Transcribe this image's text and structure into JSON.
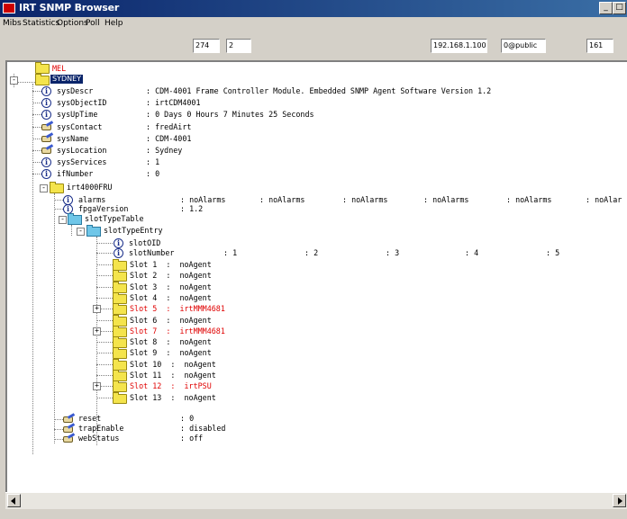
{
  "window": {
    "title": "IRT SNMP Browser"
  },
  "menu": [
    "Mibs",
    "Statistics",
    "Options",
    "Poll",
    "Help"
  ],
  "toolbar": {
    "field1": "274",
    "field2": "2",
    "ip": "192.168.1.100",
    "community": "0@public",
    "port": "161"
  },
  "tree": {
    "root_mel": "MEL",
    "root_sydney": "SYDNEY",
    "system": [
      {
        "name": "sysDescr",
        "sep": ":",
        "value": "CDM-4001 Frame Controller Module. Embedded SNMP Agent Software Version 1.2"
      },
      {
        "name": "sysObjectID",
        "sep": ":",
        "value": "irtCDM4001"
      },
      {
        "name": "sysUpTime",
        "sep": ":",
        "value": "0 Days 0 Hours 7 Minutes 25 Seconds"
      },
      {
        "name": "sysContact",
        "sep": ":",
        "value": "fredAirt"
      },
      {
        "name": "sysName",
        "sep": ":",
        "value": "CDM-4001"
      },
      {
        "name": "sysLocation",
        "sep": ":",
        "value": "Sydney"
      },
      {
        "name": "sysServices",
        "sep": ":",
        "value": "1"
      },
      {
        "name": "ifNumber",
        "sep": ":",
        "value": "0"
      }
    ],
    "fru": {
      "label": "irt4000FRU",
      "alarms_name": "alarms",
      "alarms_values": [
        ": noAlarms",
        ": noAlarms",
        ": noAlarms",
        ": noAlarms",
        ": noAlarms",
        ": noAlar"
      ],
      "fpga_name": "fpgaVersion",
      "fpga_value": ": 1.2",
      "table_label": "slotTypeTable",
      "entry_label": "slotTypeEntry",
      "slotoid": "slotOID",
      "slotnumber_name": "slotNumber",
      "slotnumber_values": [
        ": 1",
        ": 2",
        ": 3",
        ": 4",
        ": 5"
      ],
      "slots": [
        {
          "label": "Slot 1  :  noAgent"
        },
        {
          "label": "Slot 2  :  noAgent"
        },
        {
          "label": "Slot 3  :  noAgent"
        },
        {
          "label": "Slot 4  :  noAgent"
        },
        {
          "label": "Slot 5  :  irtMMM4681",
          "red": true
        },
        {
          "label": "Slot 6  :  noAgent"
        },
        {
          "label": "Slot 7  :  irtMMM4681",
          "red": true
        },
        {
          "label": "Slot 8  :  noAgent"
        },
        {
          "label": "Slot 9  :  noAgent"
        },
        {
          "label": "Slot 10  :  noAgent"
        },
        {
          "label": "Slot 11  :  noAgent"
        },
        {
          "label": "Slot 12  :  irtPSU",
          "red": true
        },
        {
          "label": "Slot 13  :  noAgent"
        }
      ],
      "reset_name": "reset",
      "reset_value": ": 0",
      "trap_name": "trapEnable",
      "trap_value": ": disabled",
      "web_name": "webStatus",
      "web_value": ": off"
    }
  },
  "colors": {
    "title_bar": "#0a246a",
    "highlight_text": "#e00000",
    "selection": "#0a246a",
    "folder": "#f4e44c",
    "table_folder": "#6fc6e8"
  }
}
